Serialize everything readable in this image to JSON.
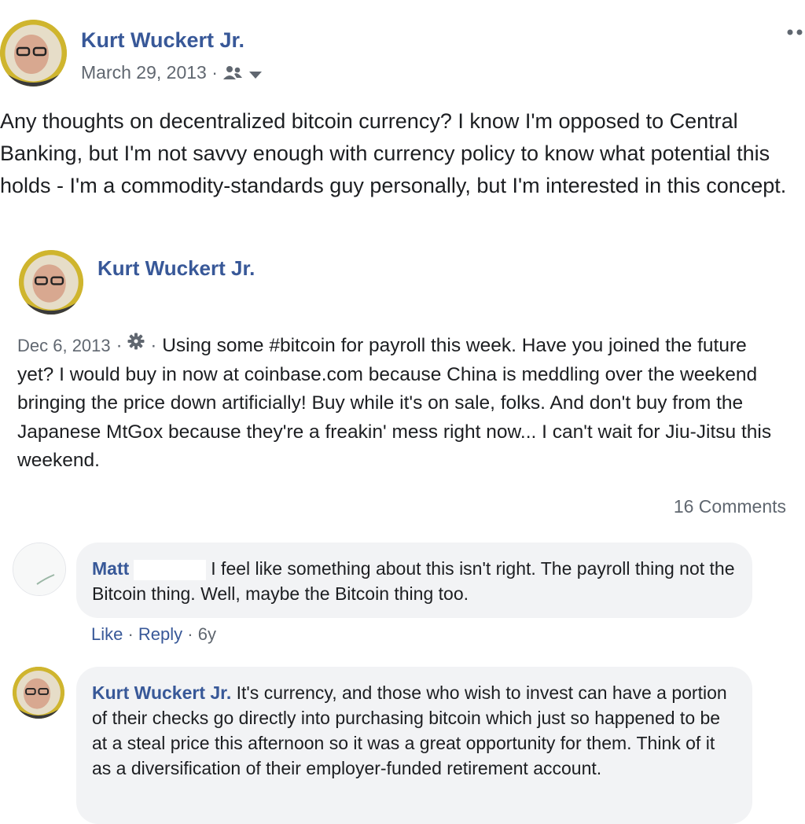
{
  "post": {
    "author": "Kurt Wuckert Jr.",
    "date": "March 29, 2013",
    "separator": " · ",
    "audience_icon": "friends-icon",
    "dropdown_icon": "caret-down-icon",
    "more_icon": "more-options-icon",
    "text": "Any thoughts on decentralized bitcoin currency? I know I'm opposed to Central Banking, but I'm not savvy enough with currency policy to know what potential this holds - I'm a commodity-standards guy personally, but I'm interested in this concept."
  },
  "shared_post": {
    "author": "Kurt Wuckert Jr.",
    "date": "Dec 6, 2013",
    "separator": " · ",
    "audience_icon": "gear-icon",
    "text": "Using some #bitcoin for payroll this week. Have you joined the future yet? I would buy in now at coinbase.com because China is meddling over the weekend bringing the price down artificially! Buy while it's on sale, folks. And don't buy from the Japanese MtGox because they're a freakin' mess right now... I can't wait for Jiu-Jitsu this weekend."
  },
  "comments_count": "16 Comments",
  "comments": [
    {
      "author": "Matt",
      "text": "I feel like something about this isn't right. The payroll thing not the Bitcoin thing. Well, maybe the Bitcoin thing too.",
      "like": "Like",
      "reply": "Reply",
      "dot": " · ",
      "age": "6y"
    },
    {
      "author": "Kurt Wuckert Jr.",
      "text": "It's currency, and those who wish to invest can have a portion of their checks go directly into purchasing bitcoin which just so happened to be at a steal price this afternoon so it was a great opportunity for them. Think of it as a diversification of their employer-funded retirement account."
    }
  ],
  "colors": {
    "link": "#385898",
    "text": "#1c1e21",
    "meta": "#606770",
    "bubble": "#f2f3f5",
    "avatar_ring": "#c8b02a"
  }
}
